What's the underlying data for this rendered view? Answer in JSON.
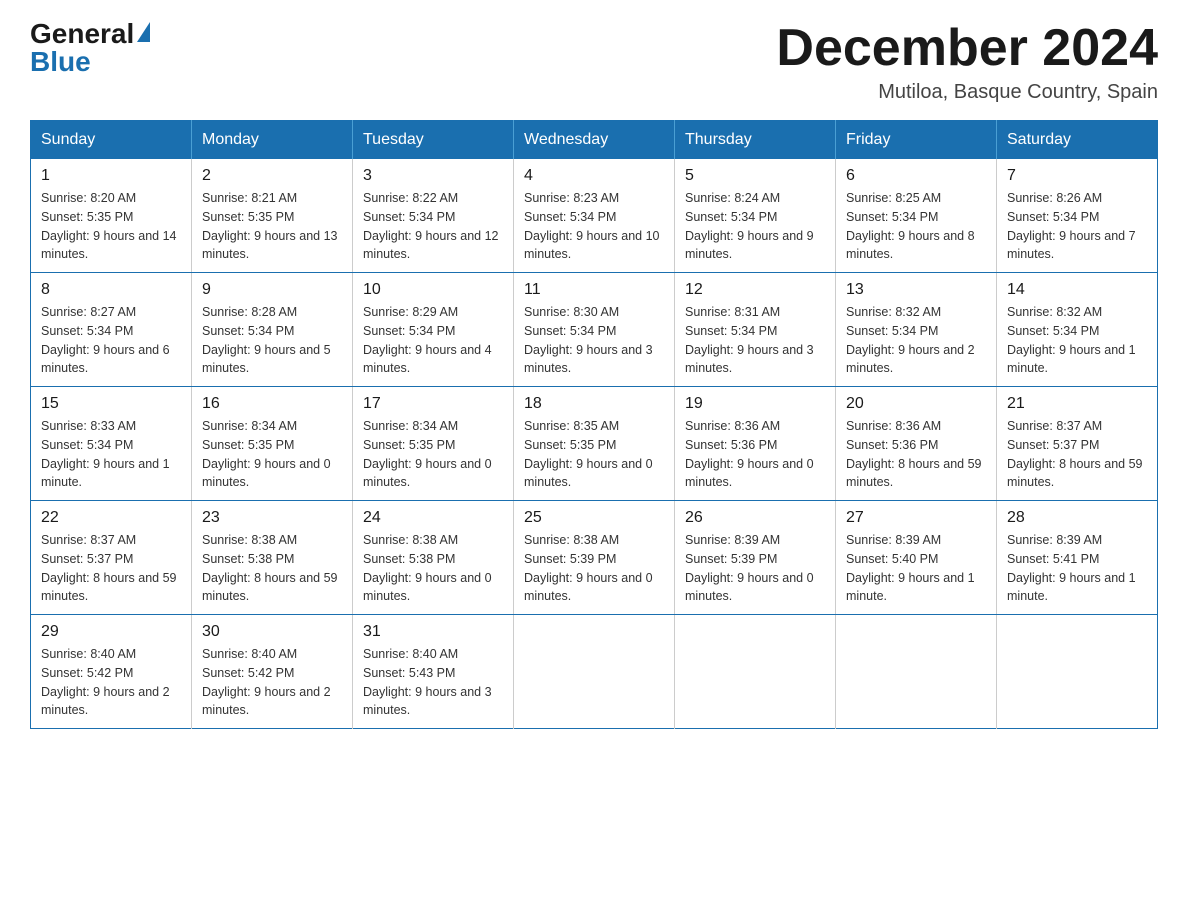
{
  "logo": {
    "general": "General",
    "blue": "Blue"
  },
  "title": "December 2024",
  "subtitle": "Mutiloa, Basque Country, Spain",
  "headers": [
    "Sunday",
    "Monday",
    "Tuesday",
    "Wednesday",
    "Thursday",
    "Friday",
    "Saturday"
  ],
  "weeks": [
    [
      {
        "day": "1",
        "sunrise": "8:20 AM",
        "sunset": "5:35 PM",
        "daylight": "9 hours and 14 minutes."
      },
      {
        "day": "2",
        "sunrise": "8:21 AM",
        "sunset": "5:35 PM",
        "daylight": "9 hours and 13 minutes."
      },
      {
        "day": "3",
        "sunrise": "8:22 AM",
        "sunset": "5:34 PM",
        "daylight": "9 hours and 12 minutes."
      },
      {
        "day": "4",
        "sunrise": "8:23 AM",
        "sunset": "5:34 PM",
        "daylight": "9 hours and 10 minutes."
      },
      {
        "day": "5",
        "sunrise": "8:24 AM",
        "sunset": "5:34 PM",
        "daylight": "9 hours and 9 minutes."
      },
      {
        "day": "6",
        "sunrise": "8:25 AM",
        "sunset": "5:34 PM",
        "daylight": "9 hours and 8 minutes."
      },
      {
        "day": "7",
        "sunrise": "8:26 AM",
        "sunset": "5:34 PM",
        "daylight": "9 hours and 7 minutes."
      }
    ],
    [
      {
        "day": "8",
        "sunrise": "8:27 AM",
        "sunset": "5:34 PM",
        "daylight": "9 hours and 6 minutes."
      },
      {
        "day": "9",
        "sunrise": "8:28 AM",
        "sunset": "5:34 PM",
        "daylight": "9 hours and 5 minutes."
      },
      {
        "day": "10",
        "sunrise": "8:29 AM",
        "sunset": "5:34 PM",
        "daylight": "9 hours and 4 minutes."
      },
      {
        "day": "11",
        "sunrise": "8:30 AM",
        "sunset": "5:34 PM",
        "daylight": "9 hours and 3 minutes."
      },
      {
        "day": "12",
        "sunrise": "8:31 AM",
        "sunset": "5:34 PM",
        "daylight": "9 hours and 3 minutes."
      },
      {
        "day": "13",
        "sunrise": "8:32 AM",
        "sunset": "5:34 PM",
        "daylight": "9 hours and 2 minutes."
      },
      {
        "day": "14",
        "sunrise": "8:32 AM",
        "sunset": "5:34 PM",
        "daylight": "9 hours and 1 minute."
      }
    ],
    [
      {
        "day": "15",
        "sunrise": "8:33 AM",
        "sunset": "5:34 PM",
        "daylight": "9 hours and 1 minute."
      },
      {
        "day": "16",
        "sunrise": "8:34 AM",
        "sunset": "5:35 PM",
        "daylight": "9 hours and 0 minutes."
      },
      {
        "day": "17",
        "sunrise": "8:34 AM",
        "sunset": "5:35 PM",
        "daylight": "9 hours and 0 minutes."
      },
      {
        "day": "18",
        "sunrise": "8:35 AM",
        "sunset": "5:35 PM",
        "daylight": "9 hours and 0 minutes."
      },
      {
        "day": "19",
        "sunrise": "8:36 AM",
        "sunset": "5:36 PM",
        "daylight": "9 hours and 0 minutes."
      },
      {
        "day": "20",
        "sunrise": "8:36 AM",
        "sunset": "5:36 PM",
        "daylight": "8 hours and 59 minutes."
      },
      {
        "day": "21",
        "sunrise": "8:37 AM",
        "sunset": "5:37 PM",
        "daylight": "8 hours and 59 minutes."
      }
    ],
    [
      {
        "day": "22",
        "sunrise": "8:37 AM",
        "sunset": "5:37 PM",
        "daylight": "8 hours and 59 minutes."
      },
      {
        "day": "23",
        "sunrise": "8:38 AM",
        "sunset": "5:38 PM",
        "daylight": "8 hours and 59 minutes."
      },
      {
        "day": "24",
        "sunrise": "8:38 AM",
        "sunset": "5:38 PM",
        "daylight": "9 hours and 0 minutes."
      },
      {
        "day": "25",
        "sunrise": "8:38 AM",
        "sunset": "5:39 PM",
        "daylight": "9 hours and 0 minutes."
      },
      {
        "day": "26",
        "sunrise": "8:39 AM",
        "sunset": "5:39 PM",
        "daylight": "9 hours and 0 minutes."
      },
      {
        "day": "27",
        "sunrise": "8:39 AM",
        "sunset": "5:40 PM",
        "daylight": "9 hours and 1 minute."
      },
      {
        "day": "28",
        "sunrise": "8:39 AM",
        "sunset": "5:41 PM",
        "daylight": "9 hours and 1 minute."
      }
    ],
    [
      {
        "day": "29",
        "sunrise": "8:40 AM",
        "sunset": "5:42 PM",
        "daylight": "9 hours and 2 minutes."
      },
      {
        "day": "30",
        "sunrise": "8:40 AM",
        "sunset": "5:42 PM",
        "daylight": "9 hours and 2 minutes."
      },
      {
        "day": "31",
        "sunrise": "8:40 AM",
        "sunset": "5:43 PM",
        "daylight": "9 hours and 3 minutes."
      },
      null,
      null,
      null,
      null
    ]
  ]
}
